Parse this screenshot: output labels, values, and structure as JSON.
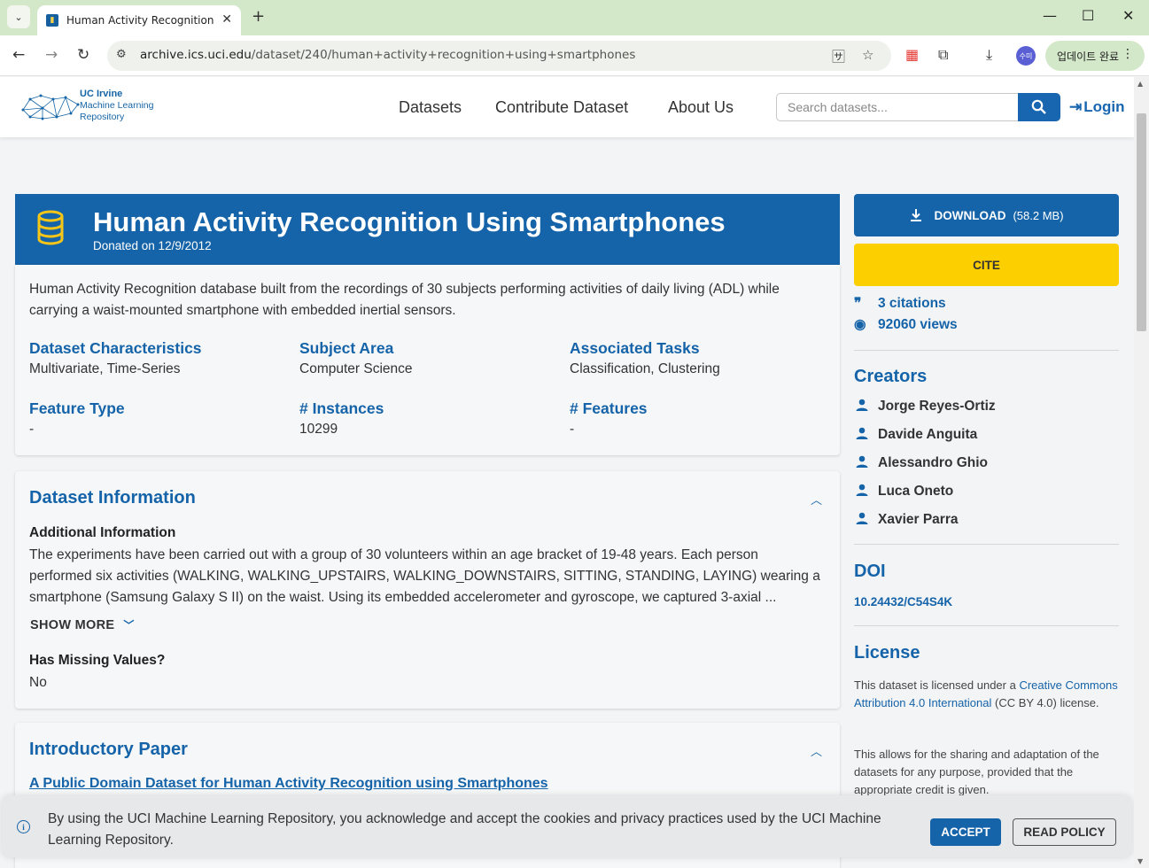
{
  "browser": {
    "tab_title": "Human Activity Recognition U",
    "url_host": "archive.ics.uci.edu",
    "url_path": "/dataset/240/human+activity+recognition+using+smartphones",
    "update_label": "업데이트 완료",
    "profile_label": "수미"
  },
  "header": {
    "logo_line1": "UC Irvine",
    "logo_line2": "Machine Learning",
    "logo_line3": "Repository",
    "nav": [
      "Datasets",
      "Contribute Dataset",
      "About Us"
    ],
    "search_placeholder": "Search datasets...",
    "login_label": "Login"
  },
  "dataset": {
    "title": "Human Activity Recognition Using Smartphones",
    "donated": "Donated on 12/9/2012",
    "summary": "Human Activity Recognition database built from the recordings of 30 subjects performing activities of daily living (ADL) while carrying a waist-mounted smartphone with embedded inertial sensors.",
    "characteristics_label": "Dataset Characteristics",
    "characteristics_value": "Multivariate, Time-Series",
    "subject_label": "Subject Area",
    "subject_value": "Computer Science",
    "tasks_label": "Associated Tasks",
    "tasks_value": "Classification, Clustering",
    "feature_type_label": "Feature Type",
    "feature_type_value": "-",
    "instances_label": "# Instances",
    "instances_value": "10299",
    "features_label": "# Features",
    "features_value": "-"
  },
  "info": {
    "title": "Dataset Information",
    "additional_label": "Additional Information",
    "additional_line1": "The experiments have been carried out with a group of 30 volunteers within an age bracket of 19-48 years. Each person",
    "additional_line2": "performed six activities (WALKING, WALKING_UPSTAIRS, WALKING_DOWNSTAIRS, SITTING, STANDING, LAYING) wearing a",
    "additional_line3": "smartphone (Samsung Galaxy S II) on the waist. Using its embedded accelerometer and gyroscope, we captured 3-axial ...",
    "show_more": "SHOW MORE",
    "missing_label": "Has Missing Values?",
    "missing_value": "No"
  },
  "paper": {
    "title": "Introductory Paper",
    "link": "A Public Domain Dataset for Human Activity Recognition using Smartphones"
  },
  "sidebar": {
    "download_label": "DOWNLOAD",
    "download_size": "(58.2 MB)",
    "cite_label": "CITE",
    "citations": "3 citations",
    "views": "92060 views",
    "creators_title": "Creators",
    "creators": [
      "Jorge Reyes-Ortiz",
      "Davide Anguita",
      "Alessandro Ghio",
      "Luca Oneto",
      "Xavier Parra"
    ],
    "doi_title": "DOI",
    "doi": "10.24432/C54S4K",
    "license_title": "License",
    "license_pre": "This dataset is licensed under a ",
    "license_link": "Creative Commons Attribution 4.0 International",
    "license_post": " (CC BY 4.0) license.",
    "license_note": "This allows for the sharing and adaptation of the datasets for any purpose, provided that the appropriate credit is given."
  },
  "cookie": {
    "text": "By using the UCI Machine Learning Repository, you acknowledge and accept the cookies and privacy practices used by the UCI Machine Learning Repository.",
    "accept": "ACCEPT",
    "policy": "READ POLICY"
  },
  "colors": {
    "primary": "#1563a8",
    "cite": "#fccf00",
    "db_icon": "#f5c518"
  }
}
